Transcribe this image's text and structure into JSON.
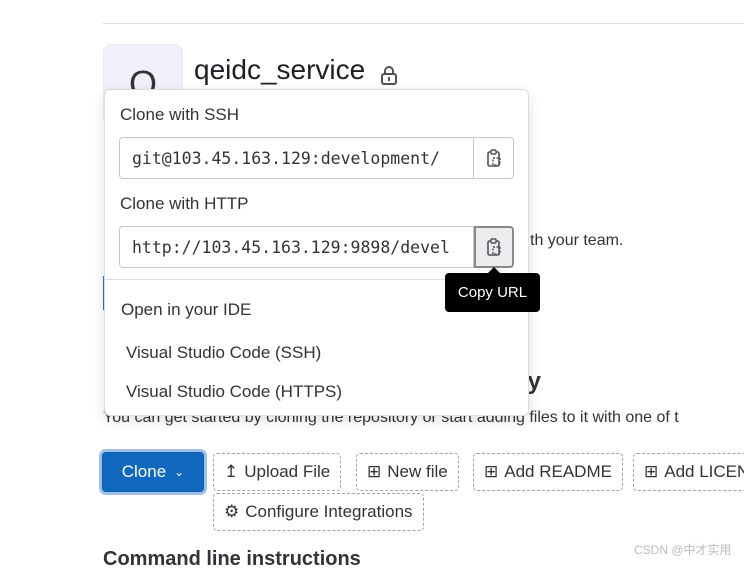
{
  "project": {
    "breadcrumb": "",
    "avatar_letter": "Q",
    "name": "qeidc_service",
    "visibility_icon": "lock-icon"
  },
  "background": {
    "invite_text_fragment": "th your team.",
    "empty_heading_fragment": "pty",
    "empty_description": "You can get started by cloning the repository or start adding files to it with one of t",
    "command_line_heading": "Command line instructions"
  },
  "actions": {
    "clone": "Clone",
    "upload_file": "Upload File",
    "new_file": "New file",
    "add_readme": "Add README",
    "add_license": "Add LICEN",
    "configure_integrations": "Configure Integrations"
  },
  "clone_popover": {
    "ssh_label": "Clone with SSH",
    "ssh_url": "git@103.45.163.129:development/",
    "http_label": "Clone with HTTP",
    "http_url": "http://103.45.163.129:9898/devel",
    "ide_heading": "Open in your IDE",
    "ide_items": [
      "Visual Studio Code (SSH)",
      "Visual Studio Code (HTTPS)"
    ],
    "copy_tooltip": "Copy URL"
  },
  "watermark": "CSDN @中才实用",
  "colors": {
    "primary": "#1068bf",
    "tooltip": "#000000"
  }
}
